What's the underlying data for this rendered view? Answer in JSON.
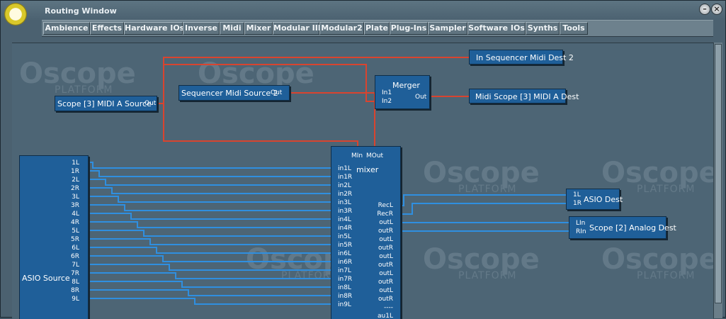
{
  "window": {
    "title": "Routing Window",
    "minimize_icon": "minimize-icon",
    "close_icon": "close-icon",
    "minimize_glyph": "–",
    "close_glyph": "×"
  },
  "menu": [
    "Ambience",
    "Effects",
    "Hardware IOs",
    "Inverse",
    "Midi",
    "Mixer",
    "Modular III",
    "Modular2",
    "Plate",
    "Plug-Ins",
    "Sampler",
    "Software IOs",
    "Synths",
    "Tools"
  ],
  "watermark": {
    "brand": "Oscope",
    "sub": "PLATFORM"
  },
  "modules": {
    "scope_midi_source": {
      "name": "Scope [3] MIDI A Source",
      "out": "Out"
    },
    "seq_midi_source": {
      "name": "Sequencer Midi Source 2",
      "out": "Out"
    },
    "merger": {
      "name": "Merger",
      "in1": "In1",
      "in2": "In2",
      "out": "Out"
    },
    "seq_midi_dest": {
      "name": "In Sequencer Midi Dest 2"
    },
    "midi_scope_dest": {
      "name": "Midi Scope [3] MIDI A Dest"
    },
    "asio_source": {
      "name": "ASIO Source",
      "outs": [
        "1L",
        "1R",
        "2L",
        "2R",
        "3L",
        "3R",
        "4L",
        "4R",
        "5L",
        "5R",
        "6L",
        "6R",
        "7L",
        "7R",
        "8L",
        "8R",
        "9L"
      ]
    },
    "mixer": {
      "name": "mixer",
      "midi_in": "MIn",
      "midi_out": "MOut",
      "ins": [
        "in1L",
        "in1R",
        "in2L",
        "in2R",
        "in3L",
        "in3R",
        "in4L",
        "in4R",
        "in5L",
        "in5R",
        "in6L",
        "in6R",
        "in7L",
        "in7R",
        "in8L",
        "in8R",
        "in9L"
      ],
      "outs": [
        "RecL",
        "RecR",
        "outL",
        "outR",
        "outL",
        "outR",
        "outL",
        "outR",
        "outL",
        "outR",
        "outL",
        "outR",
        "----",
        "au1L"
      ]
    },
    "asio_dest": {
      "name": "ASIO Dest",
      "ins": [
        "1L",
        "1R"
      ]
    },
    "analog_dest": {
      "name": "Scope [2] Analog Dest",
      "ins": [
        "LIn",
        "RIn"
      ]
    }
  },
  "colors": {
    "midi_wire": "#d9442f",
    "audio_wire": "#2f8fe0",
    "module": "#1f5f99",
    "canvas": "#4d6575"
  }
}
